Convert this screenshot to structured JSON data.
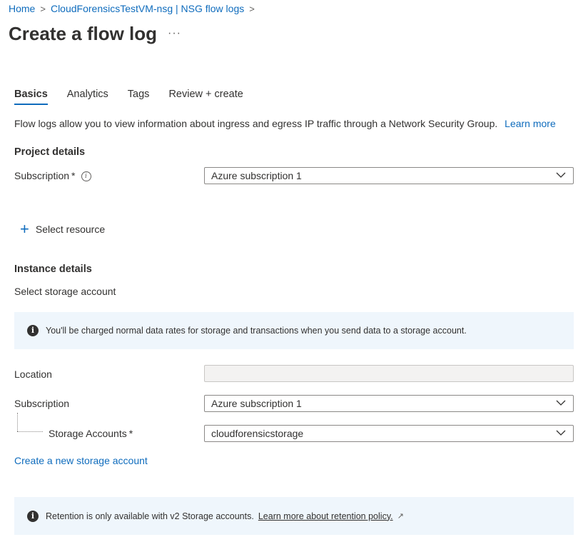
{
  "breadcrumb": {
    "items": [
      "Home",
      "CloudForensicsTestVM-nsg | NSG flow logs"
    ],
    "separator": ">"
  },
  "page": {
    "title": "Create a flow log",
    "more_actions": "···"
  },
  "tabs": [
    {
      "label": "Basics",
      "active": true
    },
    {
      "label": "Analytics",
      "active": false
    },
    {
      "label": "Tags",
      "active": false
    },
    {
      "label": "Review + create",
      "active": false
    }
  ],
  "description": {
    "text": "Flow logs allow you to view information about ingress and egress IP traffic through a Network Security Group.",
    "learn_more": "Learn more"
  },
  "project_details": {
    "title": "Project details",
    "subscription_label": "Subscription",
    "required": "*",
    "info_icon": "i",
    "subscription_value": "Azure subscription 1"
  },
  "select_resource": {
    "icon": "+",
    "label": "Select resource"
  },
  "instance_details": {
    "title": "Instance details",
    "select_storage_label": "Select storage account"
  },
  "info_banner": {
    "icon": "i",
    "text": "You'll be charged normal data rates for storage and transactions when you send data to a storage account."
  },
  "storage": {
    "location_label": "Location",
    "location_value": "",
    "subscription_label": "Subscription",
    "subscription_value": "Azure subscription 1",
    "storage_accounts_label": "Storage Accounts",
    "required": "*",
    "storage_accounts_value": "cloudforensicstorage",
    "create_new_link": "Create a new storage account"
  },
  "retention_banner": {
    "icon": "i",
    "text": "Retention is only available with v2 Storage accounts.",
    "link": "Learn more about retention policy.",
    "external_icon": "↗"
  },
  "colors": {
    "accent": "#0f6cbd",
    "banner_bg": "#eff6fc",
    "text": "#323130"
  }
}
